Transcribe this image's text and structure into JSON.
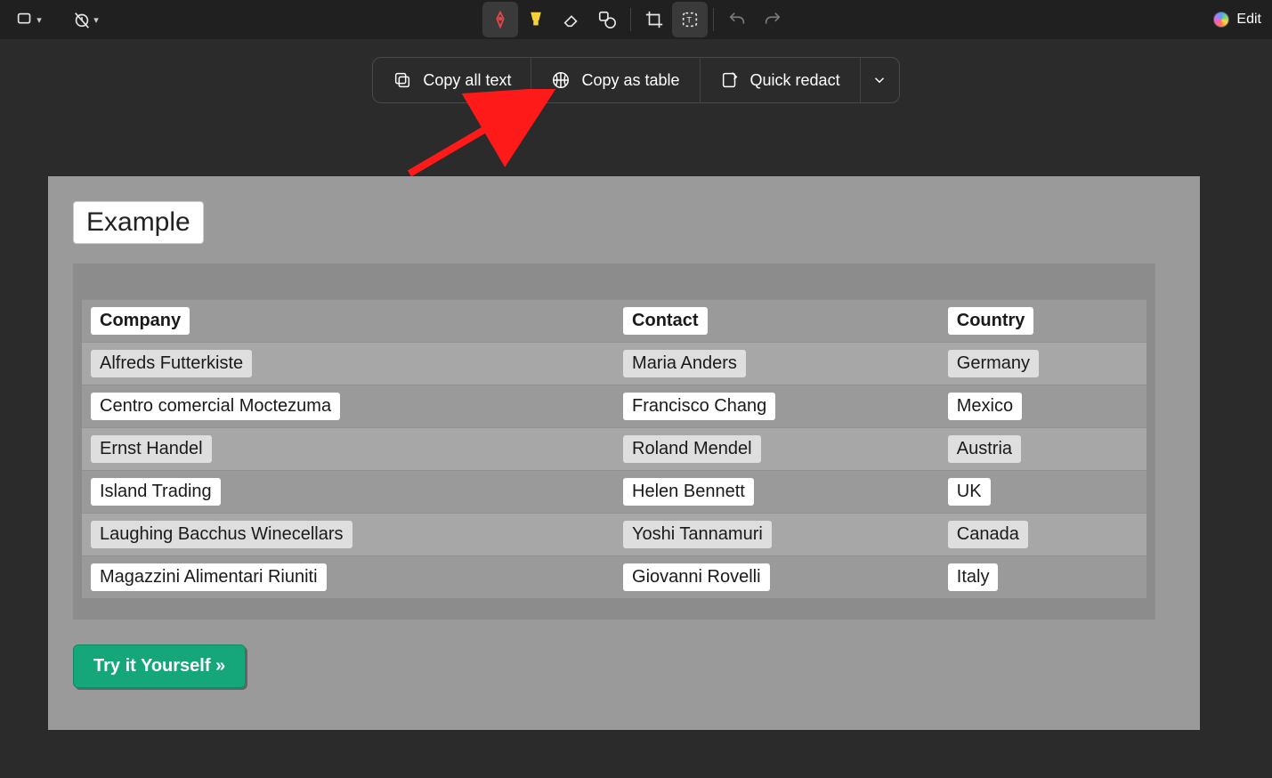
{
  "actions": {
    "copy_all_text": "Copy all text",
    "copy_as_table": "Copy as table",
    "quick_redact": "Quick redact"
  },
  "edit_label": "Edit",
  "content": {
    "heading": "Example",
    "headers": [
      "Company",
      "Contact",
      "Country"
    ],
    "rows": [
      {
        "company": "Alfreds Futterkiste",
        "contact": "Maria Anders",
        "country": "Germany"
      },
      {
        "company": "Centro comercial Moctezuma",
        "contact": "Francisco Chang",
        "country": "Mexico"
      },
      {
        "company": "Ernst Handel",
        "contact": "Roland Mendel",
        "country": "Austria"
      },
      {
        "company": "Island Trading",
        "contact": "Helen Bennett",
        "country": "UK"
      },
      {
        "company": "Laughing Bacchus Winecellars",
        "contact": "Yoshi Tannamuri",
        "country": "Canada"
      },
      {
        "company": "Magazzini Alimentari Riuniti",
        "contact": "Giovanni Rovelli",
        "country": "Italy"
      }
    ],
    "cta": "Try it Yourself »"
  }
}
